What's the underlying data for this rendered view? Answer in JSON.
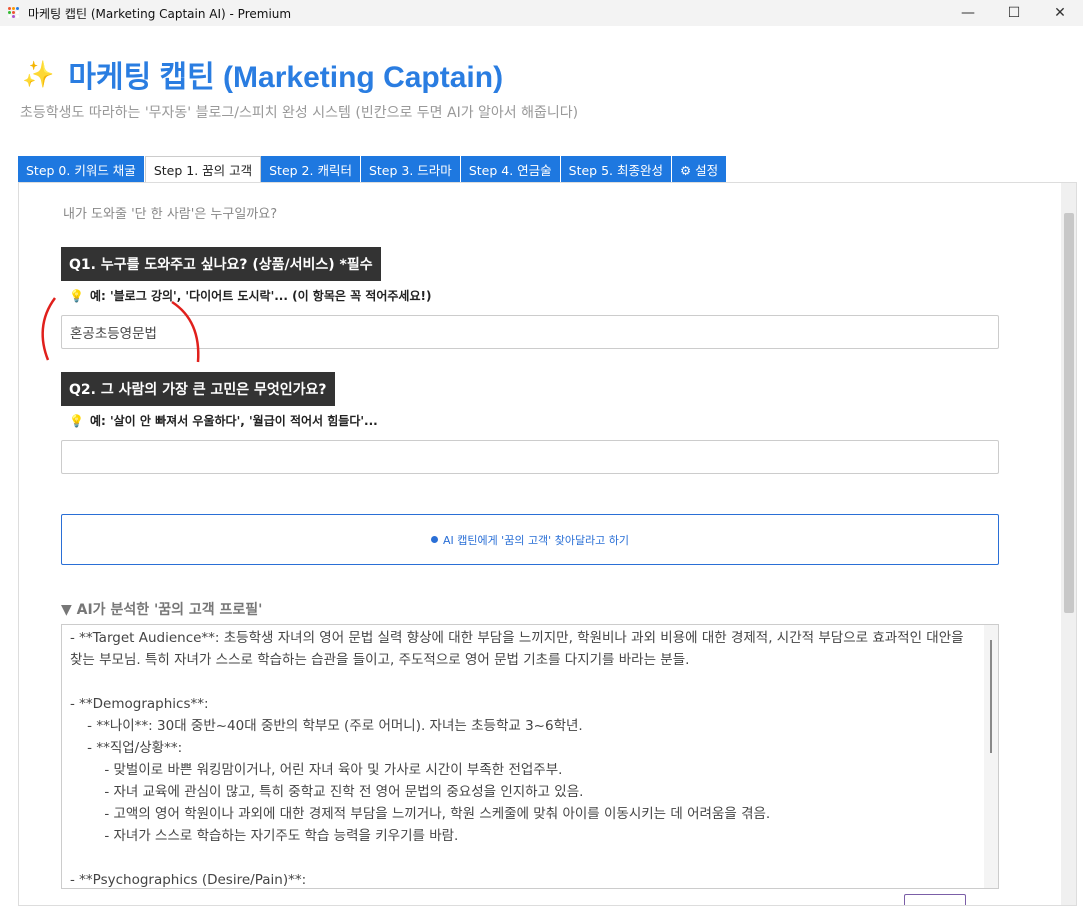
{
  "window": {
    "title": "마케팅 캡틴 (Marketing Captain AI) - Premium",
    "controls": {
      "minimize": "—",
      "maximize": "☐",
      "close": "✕"
    }
  },
  "header": {
    "icon": "✨",
    "title": "마케팅 캡틴 (Marketing Captain)",
    "subtitle": "초등학생도 따라하는 '무자동' 블로그/스피치 완성 시스템 (빈칸으로 두면 AI가 알아서 해줍니다)"
  },
  "tabs": [
    {
      "label": "Step 0. 키워드 채굴"
    },
    {
      "label": "Step 1. 꿈의 고객",
      "active": true
    },
    {
      "label": "Step 2. 캐릭터"
    },
    {
      "label": "Step 3. 드라마"
    },
    {
      "label": "Step 4. 연금술"
    },
    {
      "label": "Step 5. 최종완성"
    },
    {
      "label": "⚙ 설정"
    }
  ],
  "step1": {
    "intro": "내가 도와줄 '단 한 사람'은 누구일까요?",
    "q1": {
      "label": "Q1. 누구를 도와주고 싶나요? (상품/서비스) *필수",
      "hint": "예: '블로그 강의', '다이어트 도시락'... (이 항목은 꼭 적어주세요!)",
      "value": "혼공초등영문법"
    },
    "q2": {
      "label": "Q2. 그 사람의 가장 큰 고민은 무엇인가요?",
      "hint": "예: '살이 안 빠져서 우울하다', '월급이 적어서 힘들다'...",
      "value": ""
    },
    "ai_button": "AI 캡틴에게 '꿈의 고객' 찾아달라고 하기",
    "expander": "▼ AI가 분석한 '꿈의 고객 프로필'",
    "result": "- **Target Audience**: 초등학생 자녀의 영어 문법 실력 향상에 대한 부담을 느끼지만, 학원비나 과외 비용에 대한 경제적, 시간적 부담으로 효과적인 대안을 찾는 부모님. 특히 자녀가 스스로 학습하는 습관을 들이고, 주도적으로 영어 문법 기초를 다지기를 바라는 분들.\n\n- **Demographics**:\n    - **나이**: 30대 중반~40대 중반의 학부모 (주로 어머니). 자녀는 초등학교 3~6학년.\n    - **직업/상황**:\n        - 맞벌이로 바쁜 워킹맘이거나, 어린 자녀 육아 및 가사로 시간이 부족한 전업주부.\n        - 자녀 교육에 관심이 많고, 특히 중학교 진학 전 영어 문법의 중요성을 인지하고 있음.\n        - 고액의 영어 학원이나 과외에 대한 경제적 부담을 느끼거나, 학원 스케줄에 맞춰 아이를 이동시키는 데 어려움을 겪음.\n        - 자녀가 스스로 학습하는 자기주도 학습 능력을 키우기를 바람.\n\n- **Psychographics (Desire/Pain)**:"
  },
  "colors": {
    "accent": "#1e78e0",
    "label_bg": "#333333",
    "annotation": "#e0201c"
  }
}
